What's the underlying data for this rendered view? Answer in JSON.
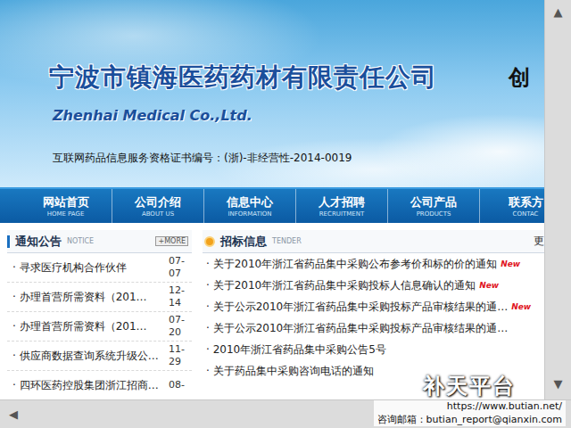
{
  "banner": {
    "company_name": "宁波市镇海医药药材有限责任公司",
    "english_name": "Zhenhai Medical Co.,Ltd.",
    "license": "互联网药品信息服务资格证书编号：(浙)-非经营性-2014-0019",
    "slogan": "创"
  },
  "nav": [
    {
      "label": "网站首页",
      "sub": "HOME PAGE"
    },
    {
      "label": "公司介绍",
      "sub": "ABOUT US"
    },
    {
      "label": "信息中心",
      "sub": "INFORMATION"
    },
    {
      "label": "人才招聘",
      "sub": "RECRUITMENT"
    },
    {
      "label": "公司产品",
      "sub": "PRODUCTS"
    },
    {
      "label": "联系方",
      "sub": "CONTAC"
    }
  ],
  "notice": {
    "title": "通知公告",
    "subtitle": "NOTICE",
    "more": "+MORE",
    "items": [
      {
        "title": "寻求医疗机构合作伙伴",
        "month": "07-",
        "day": "07"
      },
      {
        "title": "办理首营所需资料（201…",
        "month": "12-",
        "day": "14"
      },
      {
        "title": "办理首营所需资料（201…",
        "month": "07-",
        "day": "20"
      },
      {
        "title": "供应商数据查询系统升级公…",
        "month": "11-",
        "day": "29"
      },
      {
        "title": "四环医药控股集团浙江招商…",
        "month": "08-",
        "day": ""
      }
    ]
  },
  "tender": {
    "title": "招标信息",
    "subtitle": "TENDER",
    "more": "更",
    "new_label": "New",
    "items": [
      {
        "title": "关于2010年浙江省药品集中采购公布参考价和标的价的通知",
        "new": true
      },
      {
        "title": "关于2010年浙江省药品集中采购投标人信息确认的通知",
        "new": true
      },
      {
        "title": "关于公示2010年浙江省药品集中采购投标产品审核结果的通…",
        "new": true
      },
      {
        "title": "关于公示2010年浙江省药品集中采购投标产品审核结果的通…",
        "new": false
      },
      {
        "title": "2010年浙江省药品集中采购公告5号",
        "new": false
      },
      {
        "title": "关于药品集中采购咨询电话的通知",
        "new": false
      }
    ]
  },
  "scrollbars": {
    "up": "▲",
    "down": "▼",
    "left": "◀"
  },
  "watermark": {
    "title": "补天平台",
    "url": "https://www.butian.net/",
    "email": "咨询邮箱：butian_report@qianxin.com"
  }
}
